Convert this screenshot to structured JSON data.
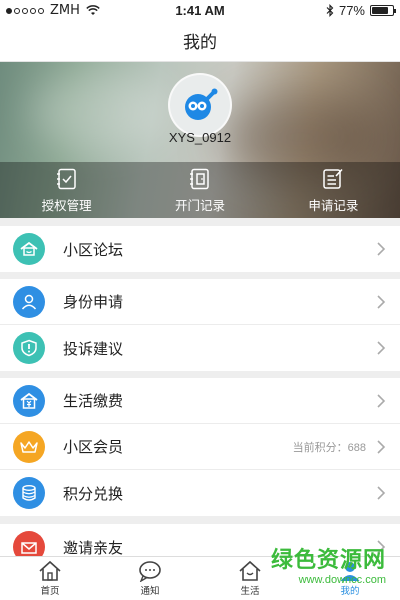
{
  "status_bar": {
    "carrier": "ZMH",
    "time": "1:41 AM",
    "battery": "77%"
  },
  "header": {
    "title": "我的"
  },
  "profile": {
    "username": "XYS_0912",
    "actions": [
      {
        "label": "授权管理",
        "icon": "authorization-icon"
      },
      {
        "label": "开门记录",
        "icon": "door-record-icon"
      },
      {
        "label": "申请记录",
        "icon": "application-record-icon"
      }
    ]
  },
  "menu": {
    "group1": [
      {
        "label": "小区论坛",
        "icon": "forum-icon",
        "color": "#3dc1b4"
      }
    ],
    "group2": [
      {
        "label": "身份申请",
        "icon": "identity-icon",
        "color": "#2f8fe3"
      },
      {
        "label": "投诉建议",
        "icon": "complaint-icon",
        "color": "#3dc1b4"
      }
    ],
    "group3": [
      {
        "label": "生活缴费",
        "icon": "payment-icon",
        "color": "#2f8fe3"
      },
      {
        "label": "小区会员",
        "icon": "crown-icon",
        "color": "#f5a623",
        "extra": "当前积分：688"
      },
      {
        "label": "积分兑换",
        "icon": "points-exchange-icon",
        "color": "#2f8fe3"
      }
    ],
    "group4": [
      {
        "label": "邀请亲友",
        "icon": "invite-icon",
        "color": "#e5493c"
      }
    ]
  },
  "tabs": [
    {
      "label": "首页",
      "icon": "home-icon"
    },
    {
      "label": "通知",
      "icon": "notification-icon"
    },
    {
      "label": "生活",
      "icon": "life-icon"
    },
    {
      "label": "我的",
      "icon": "profile-icon",
      "active": true
    }
  ],
  "watermark": {
    "title": "绿色资源网",
    "url": "www.downcc.com"
  },
  "colors": {
    "accent": "#2a8fe0",
    "teal": "#3dc1b4",
    "orange": "#f5a623",
    "red": "#e5493c"
  }
}
